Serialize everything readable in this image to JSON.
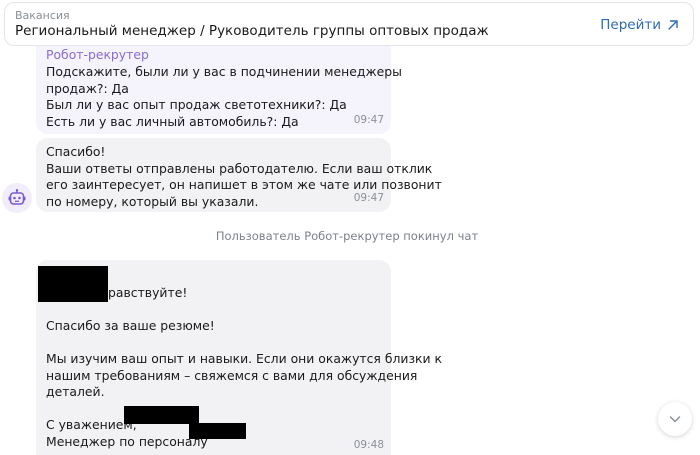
{
  "vacancy": {
    "caption": "Вакансия",
    "title": "Региональный менеджер / Руководитель группы оптовых продаж",
    "goto_label": "Перейти"
  },
  "messages": {
    "bot_answers": {
      "sender": "Робот-рекрутер",
      "lines": [
        "Подскажите, были ли у вас в подчинении менеджеры",
        "продаж?: Да",
        "Был ли у вас опыт продаж светотехники?: Да",
        "Есть ли у вас личный автомобиль?: Да"
      ],
      "time": "09:47"
    },
    "bot_thanks": {
      "lines": [
        "Спасибо!",
        "Ваши ответы отправлены работодателю. Если ваш отклик",
        "его заинтересует, он напишет в этом же чате или позвонит",
        "по номеру, который вы указали."
      ],
      "time": "09:47"
    },
    "system_note": "Пользователь Робот-рекрутер покинул чат",
    "hr": {
      "greeting": "равствуйте!",
      "thanks": "Спасибо за ваше резюме!",
      "body": [
        "Мы изучим ваш опыт и навыки. Если они окажутся близки к",
        "нашим требованиям – свяжемся с вами для обсуждения",
        "деталей."
      ],
      "regards": "С уважением,",
      "signature": "Менеджер по персоналу",
      "time": "09:48"
    }
  },
  "icons": {
    "goto": "arrow-up-right-icon",
    "avatar": "robot-icon",
    "scroll": "chevron-down-icon"
  },
  "colors": {
    "accent": "#2e6bb3",
    "sender": "#8a6bd6",
    "bot_bubble": "#f5f3fc",
    "bubble": "#f2f2f4",
    "redaction": "#000000"
  }
}
